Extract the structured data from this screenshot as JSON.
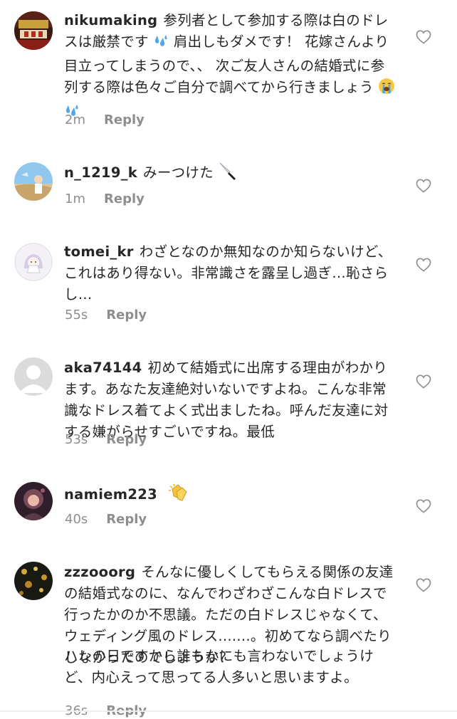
{
  "comments": [
    {
      "username": "nikumaking",
      "text": "参列者として参加する際は白のドレスは厳禁です",
      "text2": "肩出しもダメです！ 花嫁さんより目立ってしまうので、、 次ご友人さんの結婚式に参列する際は色々ご自分で調べてから行きましょう",
      "emoji_after_1": "sweat-droplets-emoji",
      "emoji_after_2": [
        "loudly-crying-face-emoji",
        "sweat-droplets-emoji"
      ],
      "time": "2m",
      "reply_label": "Reply",
      "avatar": "nikumaking-avatar"
    },
    {
      "username": "n_1219_k",
      "text": "みーつけた",
      "emoji_after": "kitchen-knife-emoji",
      "time": "1m",
      "reply_label": "Reply",
      "avatar": "n_1219_k-avatar"
    },
    {
      "username": "tomei_kr",
      "text": "わざとなのか無知なのか知らないけど、これはあり得ない。非常識さを露呈し過ぎ…恥さらし…",
      "time": "55s",
      "reply_label": "Reply",
      "avatar": "tomei_kr-avatar"
    },
    {
      "username": "aka74144",
      "text": "初めて結婚式に出席する理由がわかります。あなた友達絶対いないですよね。こんな非常識なドレス着てよく式出ましたね。呼んだ友達に対する嫌がらせすごいですね。最低",
      "time": "53s",
      "reply_label": "Reply",
      "avatar": "default-avatar"
    },
    {
      "username": "namiem223",
      "text": "",
      "emoji_after": "clapping-hands-emoji",
      "time": "40s",
      "reply_label": "Reply",
      "avatar": "namiem223-avatar"
    },
    {
      "username": "zzzooorg",
      "text": "そんなに優しくしてもらえる関係の友達の結婚式なのに、なんでわざわざこんな白ドレスで行ったかのか不思議。ただの白ドレスじゃなくて、ウェディング風のドレス.......。初めてなら調べたりしなかったのでしょうか？",
      "text2": "ハレの日ですから誰もなにも言わないでしょうけど、内心えって思ってる人多いと思いますよ。",
      "time": "36s",
      "reply_label": "Reply",
      "avatar": "zzzooorg-avatar"
    }
  ],
  "icons": {
    "like": "heart-outline-icon"
  },
  "colors": {
    "text": "#262626",
    "meta": "#8e8e8e",
    "heart_stroke": "#8e8e8e",
    "sweat_blue": "#4fa6e8",
    "clap_yellow": "#f5c542"
  }
}
